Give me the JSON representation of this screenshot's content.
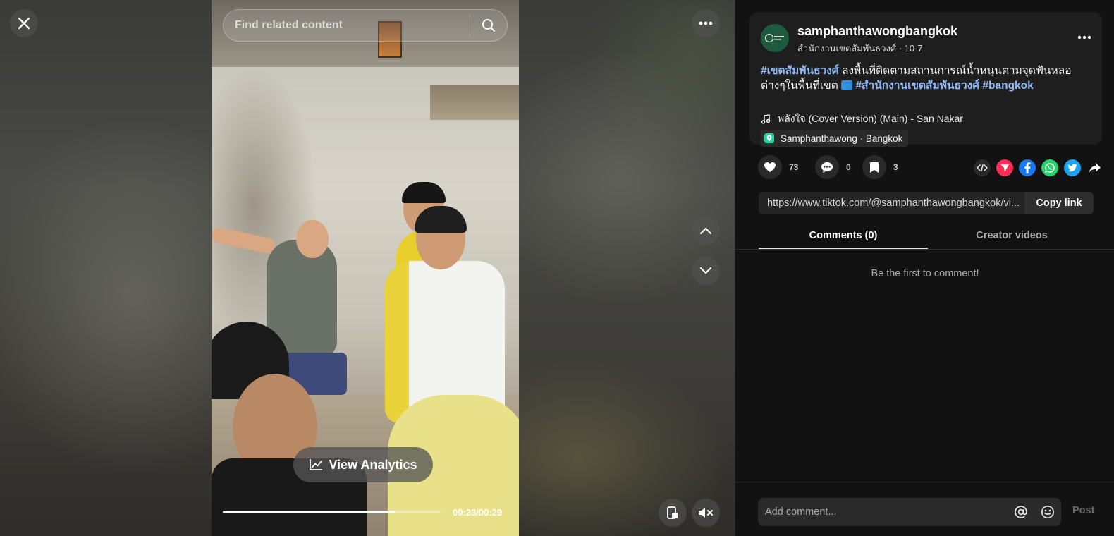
{
  "search": {
    "placeholder": "Find related content"
  },
  "video": {
    "analytics_label": "View Analytics",
    "time": "00:23/00:29",
    "progress": 0.79
  },
  "post": {
    "username": "samphanthawongbangkok",
    "display_name": "สำนักงานเขตสัมพันธวงศ์",
    "date": "10-7",
    "caption_tag1": "#เขตสัมพันธวงศ์",
    "caption_text1": " ลงพื้นที่ติดตามสถานการณ์น้ำหนุนตามจุดฟันหลอต่างๆในพื้นที่เขต ",
    "caption_tag2": "#สำนักงานเขตสัมพันธวงศ์",
    "caption_tag3": "#bangkok",
    "music": "พลังใจ (Cover Version) (Main) - San Nakar",
    "location": "Samphanthawong · Bangkok"
  },
  "stats": {
    "likes": "73",
    "comments": "0",
    "saves": "3"
  },
  "share_icons": [
    "embed-icon",
    "send-to-friends-icon",
    "facebook-icon",
    "whatsapp-icon",
    "twitter-icon",
    "share-arrow-icon"
  ],
  "link": {
    "url": "https://www.tiktok.com/@samphanthawongbangkok/vi...",
    "copy_label": "Copy link"
  },
  "tabs": [
    {
      "label": "Comments (0)",
      "active": true
    },
    {
      "label": "Creator videos",
      "active": false
    }
  ],
  "comments": {
    "empty_message": "Be the first to comment!"
  },
  "composer": {
    "placeholder": "Add comment...",
    "post_label": "Post"
  },
  "colors": {
    "tag": "#8fb8f5",
    "send_red": "#fe2c55",
    "facebook": "#1877f2",
    "whatsapp": "#25d366",
    "twitter": "#1da1f2",
    "location_pin": "#20d5a0"
  }
}
